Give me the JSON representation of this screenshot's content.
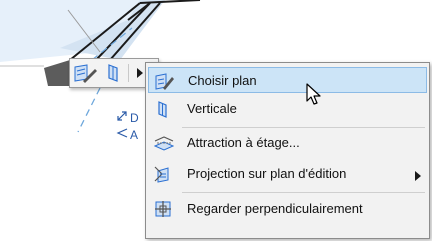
{
  "pet_palette": {
    "buttons": [
      {
        "icon": "choose-plane-icon"
      },
      {
        "icon": "vertical-icon"
      },
      {
        "icon": "submenu-arrow-icon"
      }
    ]
  },
  "background_hints": [
    {
      "icon": "resize-arrow-icon",
      "text": "D"
    },
    {
      "icon": "angle-icon",
      "text": "A"
    }
  ],
  "menu": {
    "items": [
      {
        "label": "Choisir plan",
        "icon": "choose-plane-icon",
        "highlighted": true
      },
      {
        "label": "Verticale",
        "icon": "vertical-plane-icon"
      },
      {
        "label": "Attraction à étage...",
        "icon": "story-snap-icon"
      },
      {
        "label": "Projection sur plan d'édition",
        "icon": "projection-icon",
        "has_submenu": true
      },
      {
        "label": "Regarder perpendiculairement",
        "icon": "look-perpendicular-icon"
      }
    ]
  },
  "colors": {
    "highlight_bg": "#cce4f7",
    "highlight_border": "#8cbbe6",
    "menu_bg": "#f2f2f2",
    "icon_blue": "#2a6fd1"
  }
}
